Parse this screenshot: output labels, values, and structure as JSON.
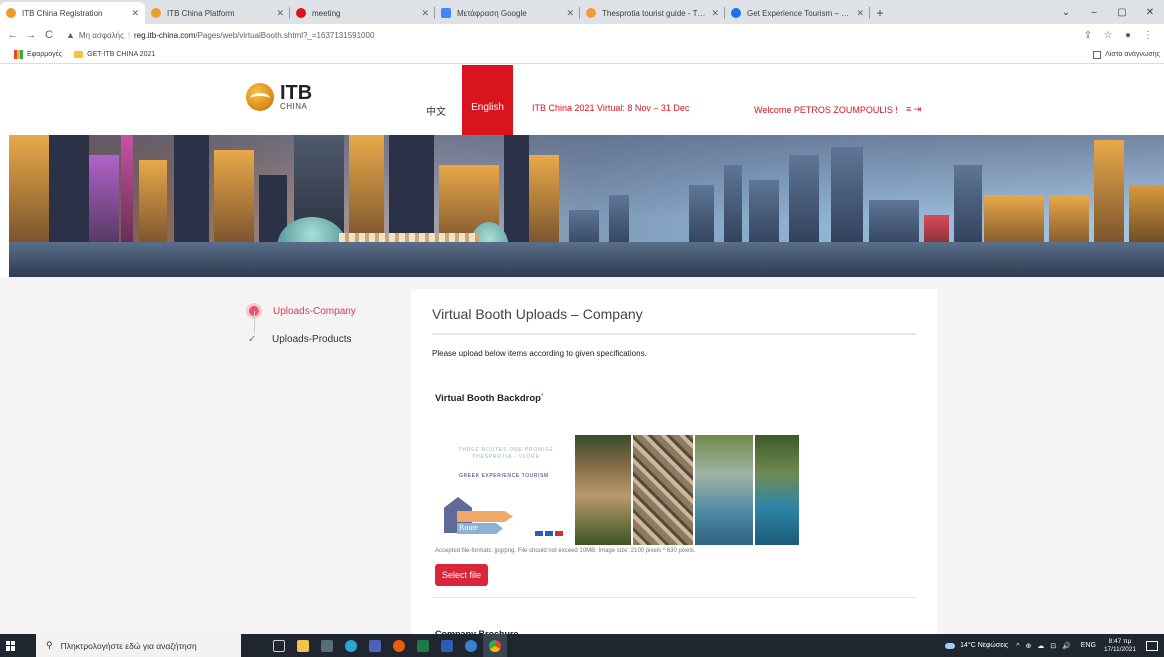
{
  "browser": {
    "tabs": [
      {
        "title": "ITB China Registration",
        "active": true,
        "favicon_color": "#e8a02a"
      },
      {
        "title": "ITB China Platform",
        "active": false,
        "favicon_color": "#e8a02a"
      },
      {
        "title": "meeting",
        "active": false,
        "favicon_color": "#d9141e"
      },
      {
        "title": "Μετάφραση Google",
        "active": false,
        "favicon_color": "#4285f4"
      },
      {
        "title": "Thesprotia tourist guide - Thespr",
        "active": false,
        "favicon_color": "#f29b38"
      },
      {
        "title": "Get Experience Tourism – Get Ex",
        "active": false,
        "favicon_color": "#1a73e8"
      }
    ],
    "new_tab": "+",
    "window_controls": [
      "⌄",
      "–",
      "▢",
      "✕"
    ],
    "address": {
      "security": "Μη ασφαλής",
      "host": "reg.itb-china.com",
      "path": "/Pages/web/virtualBooth.shtml?_=1637131591000"
    },
    "bookmarks": {
      "apps": "Εφαρμογές",
      "folder": "GET-ITB CHINA 2021",
      "reading_list": "Λίστα ανάγνωσης"
    }
  },
  "header": {
    "logo_big": "ITB",
    "logo_small": "CHINA",
    "lang_cn": "中文",
    "lang_en": "English",
    "event": "ITB China 2021 Virtual: 8 Nov – 31 Dec",
    "welcome": "Welcome PETROS ZOUMPOULIS !",
    "menu_icons": "≡ ⇥"
  },
  "sidebar": {
    "items": [
      {
        "label": "Uploads-Company",
        "state": "current"
      },
      {
        "label": "Uploads-Products",
        "state": "done"
      }
    ]
  },
  "main": {
    "title": "Virtual Booth Uploads – Company",
    "intro": "Please upload below items according to given specifications.",
    "section_title": "Virtual Booth Backdrop",
    "required_mark": "*",
    "preview": {
      "tagline": "THREE ROUTES ONE PROMISE THESPROTIA - VLORE",
      "brand": "GREEK EXPERIENCE TOURISM",
      "logo_text": "Route"
    },
    "note": "Accepted file-formats: jpg/png. File should not exceed 10MB. Image size: 2100 pixels * 630 pixels.",
    "select_button": "Select file",
    "next_section": "Company Brochure"
  },
  "taskbar": {
    "search_placeholder": "Πληκτρολογήστε εδώ για αναζήτηση",
    "weather": "14°C Νεφώσεις",
    "tray_icons": "^ ⊕ ☁ ⊡ 🔊",
    "lang": "ENG",
    "time": "8:47 πμ",
    "date": "17/11/2021"
  }
}
